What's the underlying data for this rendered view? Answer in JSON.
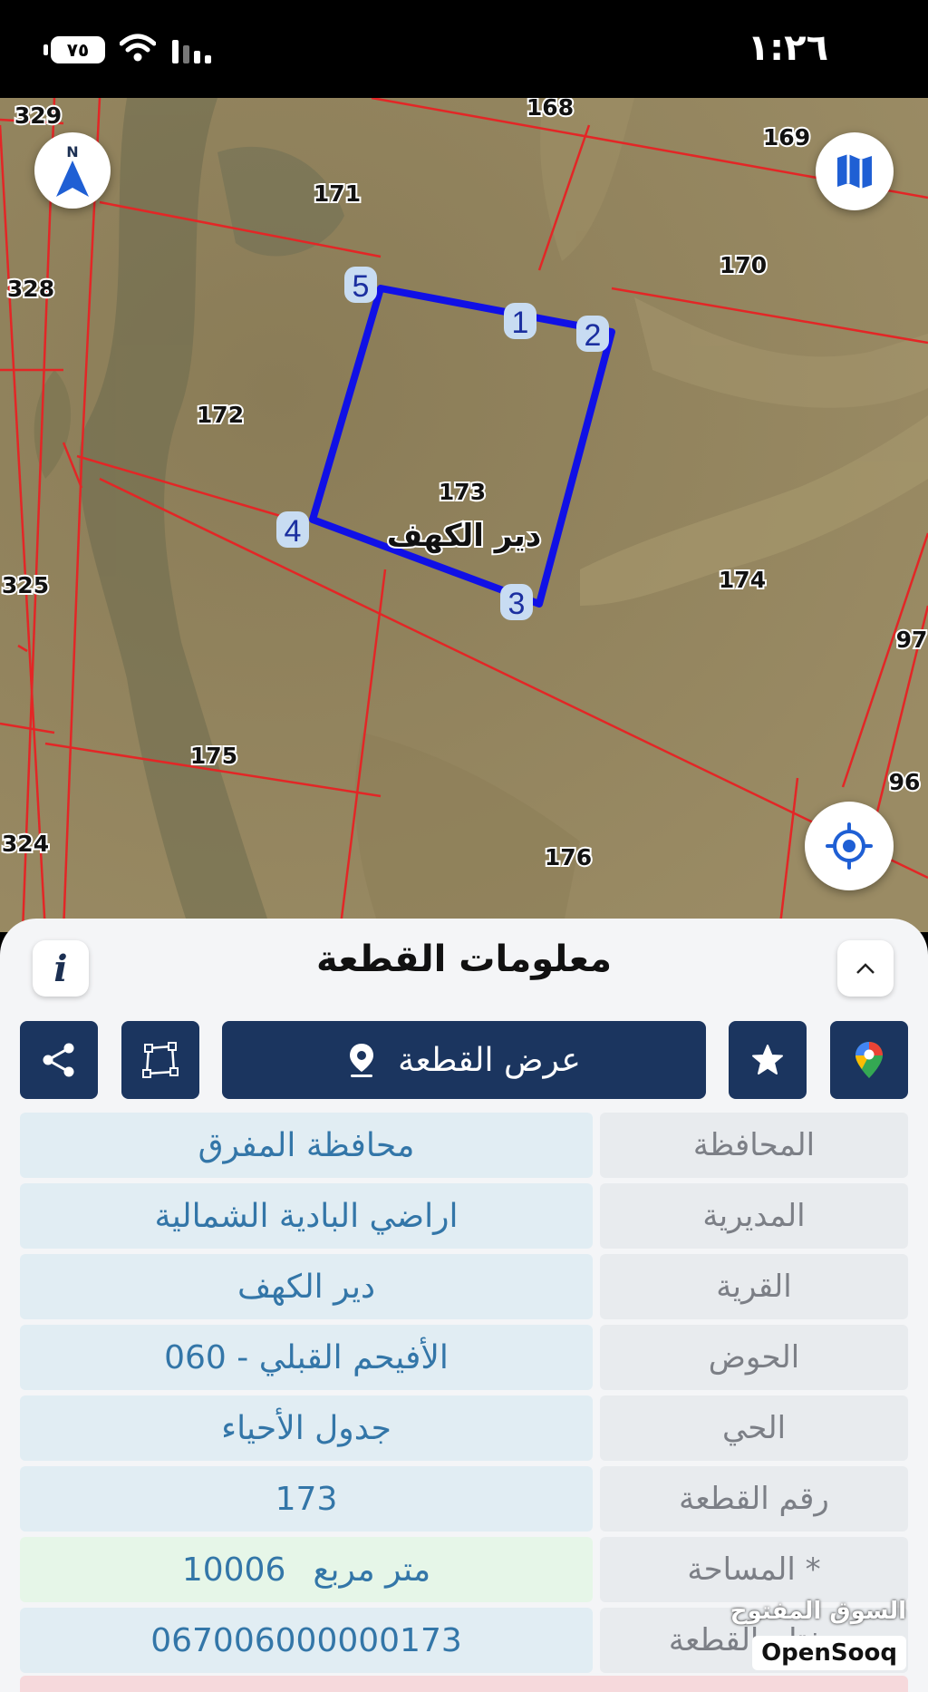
{
  "status_bar": {
    "battery": "٧٥",
    "time": "١:٢٦"
  },
  "map": {
    "parcel_labels": {
      "p329": "329",
      "p168": "168",
      "p169": "169",
      "p171": "171",
      "p170": "170",
      "p328": "328",
      "p172": "172",
      "p173": "173",
      "p174": "174",
      "p325": "325",
      "p97": "97",
      "p175": "175",
      "p96": "96",
      "p324": "324",
      "p176": "176"
    },
    "village_label": "دير الكهف",
    "vertex_labels": {
      "v1": "1",
      "v2": "2",
      "v3": "3",
      "v4": "4",
      "v5": "5"
    },
    "compass_letter": "N"
  },
  "panel": {
    "title": "معلومات القطعة",
    "show_parcel_label": "عرض القطعة",
    "rows": [
      {
        "label": "المحافظة",
        "value": "محافظة المفرق"
      },
      {
        "label": "المديرية",
        "value": "اراضي البادية الشمالية"
      },
      {
        "label": "القرية",
        "value": "دير الكهف"
      },
      {
        "label": "الحوض",
        "value": "الأفيحم القبلي - 060"
      },
      {
        "label": "الحي",
        "value": "جدول الأحياء"
      },
      {
        "label": "رقم القطعة",
        "value": "173"
      },
      {
        "label": "المساحة *",
        "value": "10006",
        "unit": "متر مربع"
      },
      {
        "label": "مفتاح القطعة",
        "value": "067006000000173"
      }
    ]
  },
  "watermark": {
    "arabic": "السوق المفتوح",
    "latin": "OpenSooq"
  },
  "colors": {
    "navy": "#1b355f",
    "parcel_outline": "#1010e6",
    "boundary": "#e32626",
    "value_text": "#3376a8"
  }
}
